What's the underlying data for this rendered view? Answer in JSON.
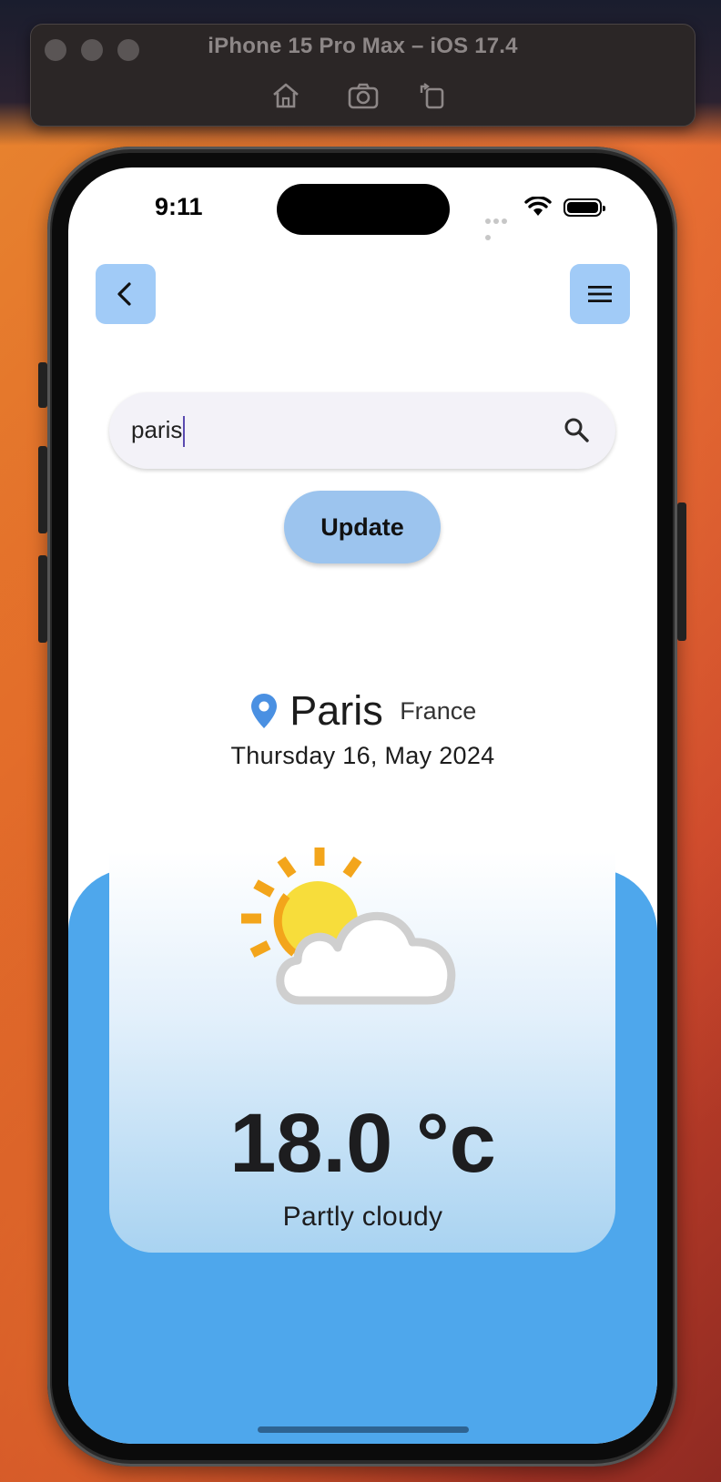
{
  "simulator": {
    "title": "iPhone 15 Pro Max – iOS 17.4",
    "toolbar": [
      "home-icon",
      "screenshot-icon",
      "rotate-icon"
    ]
  },
  "status_bar": {
    "time": "9:11"
  },
  "nav": {
    "back_icon": "chevron-left-icon",
    "menu_icon": "hamburger-menu-icon"
  },
  "search": {
    "value": "paris",
    "icon": "search-icon"
  },
  "update_button": {
    "label": "Update"
  },
  "location": {
    "city": "Paris",
    "country": "France",
    "date": "Thursday 16, May 2024",
    "icon": "location-pin-icon"
  },
  "weather": {
    "icon": "partly-cloudy-icon",
    "temperature": "18.0 °c",
    "condition": "Partly cloudy"
  },
  "colors": {
    "accent_button": "#a1cbf7",
    "update_button": "#9cc4ee",
    "blue_background": "#4ea7ec",
    "pin": "#4a90e2"
  }
}
